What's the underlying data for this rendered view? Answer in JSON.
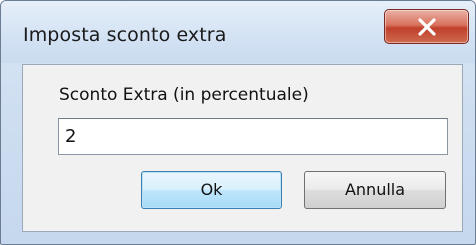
{
  "window": {
    "title": "Imposta sconto extra"
  },
  "form": {
    "label": "Sconto Extra (in percentuale)",
    "value": "2"
  },
  "buttons": {
    "ok_label": "Ok",
    "cancel_label": "Annulla"
  },
  "colors": {
    "close_button": "#c8442e",
    "default_button_border": "#3c7fb1",
    "dialog_background": "#f1f1f1",
    "frame": "#cfdff1"
  },
  "icons": {
    "close": "close-icon"
  }
}
